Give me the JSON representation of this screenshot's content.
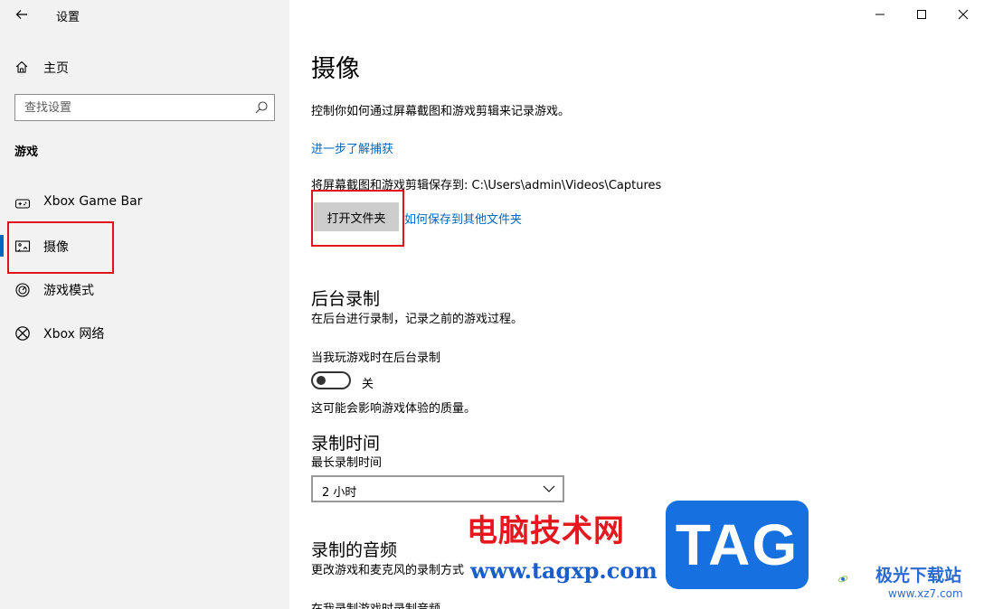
{
  "window": {
    "app_title": "设置"
  },
  "sidebar": {
    "home_label": "主页",
    "search_placeholder": "查找设置",
    "section_title": "游戏",
    "items": [
      {
        "label": "Xbox Game Bar",
        "icon": "xbox-game-bar-icon",
        "selected": false
      },
      {
        "label": "摄像",
        "icon": "captures-icon",
        "selected": true
      },
      {
        "label": "游戏模式",
        "icon": "game-mode-icon",
        "selected": false
      },
      {
        "label": "Xbox 网络",
        "icon": "xbox-icon",
        "selected": false
      }
    ]
  },
  "main": {
    "title": "摄像",
    "description": "控制你如何通过屏幕截图和游戏剪辑来记录游戏。",
    "learn_more_link": "进一步了解捕获",
    "save_path_label": "将屏幕截图和游戏剪辑保存到: C:\\Users\\admin\\Videos\\Captures",
    "open_folder_button": "打开文件夹",
    "save_elsewhere_link": "如何保存到其他文件夹",
    "background_recording": {
      "heading": "后台录制",
      "description": "在后台进行录制，记录之前的游戏过程。",
      "toggle_label": "当我玩游戏时在后台录制",
      "toggle_state": "关",
      "toggle_on": false,
      "note": "这可能会影响游戏体验的质量。"
    },
    "recording_length": {
      "heading": "录制时间",
      "label": "最长录制时间",
      "selected": "2 小时"
    },
    "recorded_audio": {
      "heading": "录制的音频",
      "description": "更改游戏和麦克风的录制方式",
      "partial_text": "在我录制游戏时录制音频"
    }
  },
  "watermark": {
    "site_name": "电脑技术网",
    "site_url": "www.tagxp.com",
    "tag_text": "TAG",
    "brand_name": "极光下载站",
    "brand_url": "www.xz7.com"
  },
  "colors": {
    "accent": "#0067c0",
    "highlight_outline": "#e0141e",
    "sidebar_bg": "#f2f2f2"
  }
}
